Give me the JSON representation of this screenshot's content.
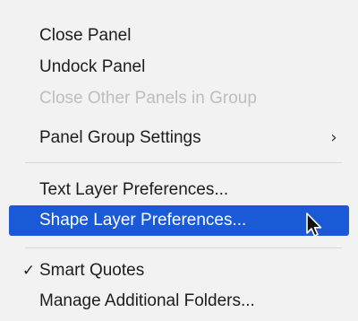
{
  "menu": {
    "items": [
      {
        "label": "Close Panel",
        "enabled": true
      },
      {
        "label": "Undock Panel",
        "enabled": true
      },
      {
        "label": "Close Other Panels in Group",
        "enabled": false
      },
      {
        "label": "Panel Group Settings",
        "enabled": true,
        "submenu_indicator": "›"
      },
      {
        "label": "Text Layer Preferences...",
        "enabled": true
      },
      {
        "label": "Shape Layer Preferences...",
        "enabled": true,
        "highlighted": true
      },
      {
        "label": "Smart Quotes",
        "enabled": true,
        "checked": true,
        "check_mark": "✓"
      },
      {
        "label": "Manage Additional Folders...",
        "enabled": true
      }
    ]
  },
  "colors": {
    "menu_background": "#f2f2f2",
    "highlight": "#1a5ad7",
    "text": "#1d1d1d",
    "disabled_text": "#bdbdbd",
    "separator": "#d6d6d6"
  },
  "icons": {
    "submenu": "chevron-right-icon",
    "check": "checkmark-icon",
    "pointer": "mouse-pointer-icon"
  }
}
